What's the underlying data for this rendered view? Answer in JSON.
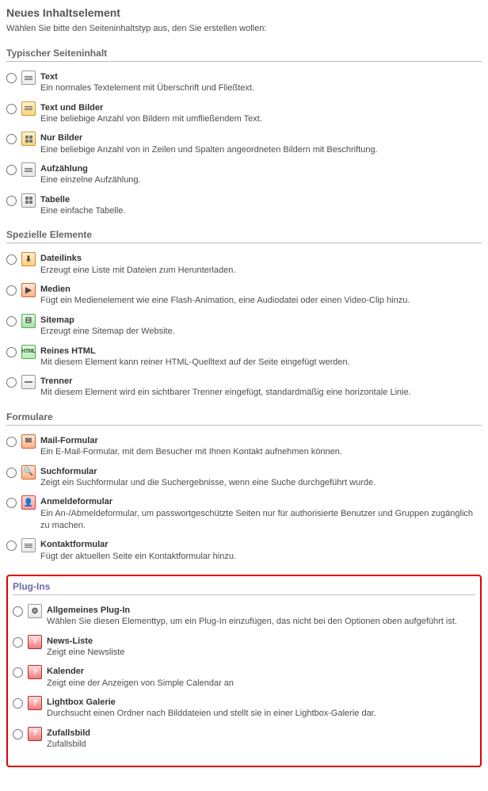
{
  "header": {
    "title": "Neues Inhaltselement",
    "subtitle": "Wählen Sie bitte den Seiteninhaltstyp aus, den Sie erstellen wollen:"
  },
  "sections": {
    "typical": {
      "heading": "Typischer Seiteninhalt",
      "items": {
        "text": {
          "title": "Text",
          "desc": "Ein normales Textelement mit Überschrift und Fließtext."
        },
        "textimg": {
          "title": "Text und Bilder",
          "desc": "Eine beliebige Anzahl von Bildern mit umfließendem Text."
        },
        "img": {
          "title": "Nur Bilder",
          "desc": "Eine beliebige Anzahl von in Zeilen und Spalten angeordneten Bildern mit Beschriftung."
        },
        "list": {
          "title": "Aufzählung",
          "desc": "Eine einzelne Aufzählung."
        },
        "table": {
          "title": "Tabelle",
          "desc": "Eine einfache Tabelle."
        }
      }
    },
    "special": {
      "heading": "Spezielle Elemente",
      "items": {
        "file": {
          "title": "Dateilinks",
          "desc": "Erzeugt eine Liste mit Dateien zum Herunterladen."
        },
        "media": {
          "title": "Medien",
          "desc": "Fügt ein Medienelement wie eine Flash-Animation, eine Audiodatei oder einen Video-Clip hinzu."
        },
        "sitemap": {
          "title": "Sitemap",
          "desc": "Erzeugt eine Sitemap der Website."
        },
        "html": {
          "title": "Reines HTML",
          "desc": "Mit diesem Element kann reiner HTML-Quelltext auf der Seite eingefügt werden."
        },
        "hr": {
          "title": "Trenner",
          "desc": "Mit diesem Element wird ein sichtbarer Trenner eingefügt, standardmäßig eine horizontale Linie."
        }
      }
    },
    "forms": {
      "heading": "Formulare",
      "items": {
        "mail": {
          "title": "Mail-Formular",
          "desc": "Ein E-Mail-Formular, mit dem Besucher mit Ihnen Kontakt aufnehmen können."
        },
        "search": {
          "title": "Suchformular",
          "desc": "Zeigt ein Suchformular und die Suchergebnisse, wenn eine Suche durchgeführt wurde."
        },
        "login": {
          "title": "Anmeldeformular",
          "desc": "Ein An-/Abmeldeformular, um passwortgeschützte Seiten nur für authorisierte Benutzer und Gruppen zugänglich zu machen."
        },
        "contact": {
          "title": "Kontaktformular",
          "desc": "Fügt der aktuellen Seite ein Kontaktformular hinzu."
        }
      }
    },
    "plugins": {
      "heading": "Plug-Ins",
      "items": {
        "general": {
          "title": "Allgemeines Plug-In",
          "desc": "Wählen Sie diesen Elementtyp, um ein Plug-In einzufügen, das nicht bei den Optionen oben aufgeführt ist."
        },
        "news": {
          "title": "News-Liste",
          "desc": "Zeigt eine Newsliste"
        },
        "cal": {
          "title": "Kalender",
          "desc": "Zeigt eine der Anzeigen von Simple Calendar an"
        },
        "lightbox": {
          "title": "Lightbox Galerie",
          "desc": "Durchsucht einen Ordner nach Bilddateien und stellt sie in einer Lightbox-Galerie dar."
        },
        "random": {
          "title": "Zufallsbild",
          "desc": "Zufallsbild"
        }
      }
    }
  }
}
